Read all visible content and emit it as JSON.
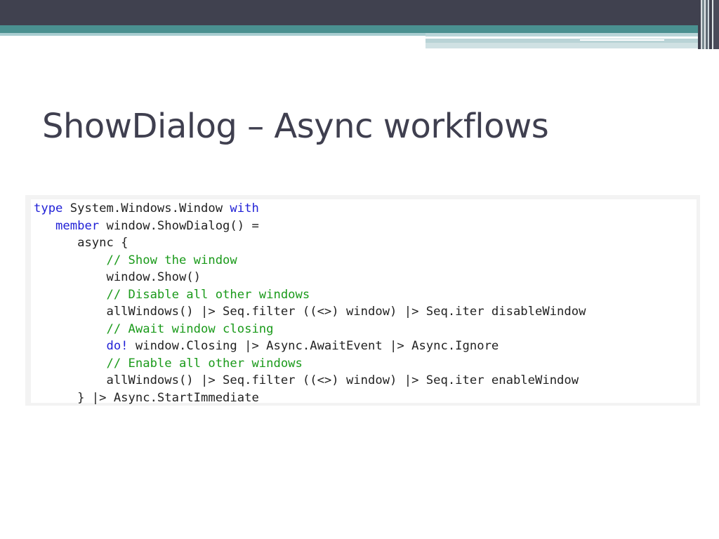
{
  "slide": {
    "title": "ShowDialog – Async workflows"
  },
  "code": {
    "lines": [
      {
        "indent": "",
        "keyword": "type",
        "text": " System.Windows.Window ",
        "keyword2": "with",
        "text2": ""
      },
      {
        "indent": "   ",
        "keyword": "member",
        "text": " window.ShowDialog() ="
      },
      {
        "indent": "      ",
        "text": "async {"
      },
      {
        "indent": "          ",
        "comment": "// Show the window"
      },
      {
        "indent": "          ",
        "text": "window.Show()"
      },
      {
        "indent": "          ",
        "comment": "// Disable all other windows"
      },
      {
        "indent": "          ",
        "text": "allWindows() |> Seq.filter ((<>) window) |> Seq.iter disableWindow"
      },
      {
        "indent": "          ",
        "comment": "// Await window closing"
      },
      {
        "indent": "          ",
        "keyword": "do!",
        "text": " window.Closing |> Async.AwaitEvent |> Async.Ignore"
      },
      {
        "indent": "          ",
        "comment": "// Enable all other windows"
      },
      {
        "indent": "          ",
        "text": "allWindows() |> Seq.filter ((<>) window) |> Seq.iter enableWindow"
      },
      {
        "indent": "      ",
        "text": "} |> Async.StartImmediate"
      }
    ]
  },
  "colors": {
    "header_dark": "#40414f",
    "header_teal": "#4a9090",
    "title": "#3f3f4f",
    "keyword": "#1f1fd6",
    "comment": "#1a9a1a",
    "code_text": "#222222"
  }
}
